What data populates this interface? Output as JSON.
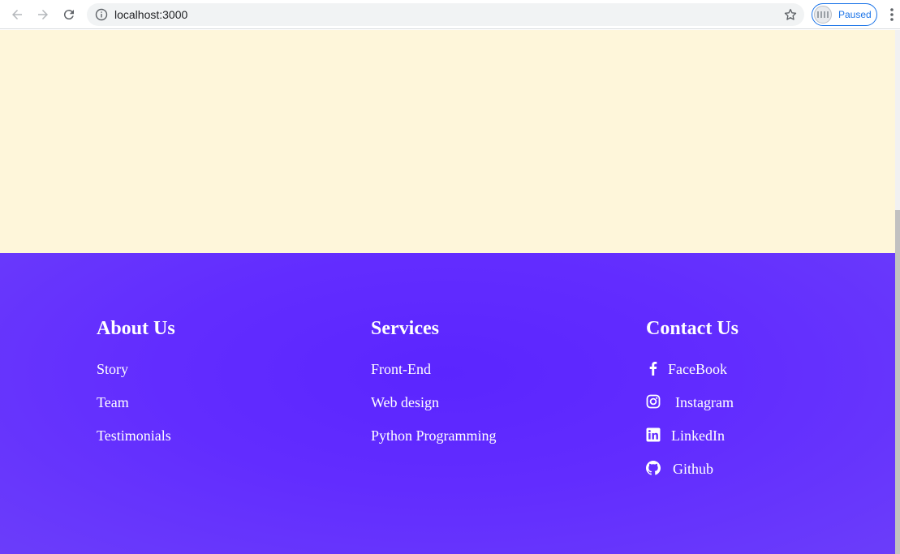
{
  "browser": {
    "url": "localhost:3000",
    "profile_status": "Paused",
    "icons": [
      "back-arrow-icon",
      "forward-arrow-icon",
      "reload-icon",
      "info-icon",
      "star-icon",
      "kebab-menu-icon"
    ]
  },
  "colors": {
    "hero_bg": "#fef6da",
    "footer_bg": "#622cff",
    "text": "#ffffff"
  },
  "footer": {
    "about": {
      "heading": "About Us",
      "links": [
        "Story",
        "Team",
        "Testimonials"
      ]
    },
    "services": {
      "heading": "Services",
      "links": [
        "Front-End",
        "Web design",
        "Python Programming"
      ]
    },
    "contact": {
      "heading": "Contact Us",
      "links": [
        {
          "label": "FaceBook",
          "icon": "facebook-icon"
        },
        {
          "label": "Instagram",
          "icon": "instagram-icon"
        },
        {
          "label": "LinkedIn",
          "icon": "linkedin-icon"
        },
        {
          "label": "Github",
          "icon": "github-icon"
        }
      ]
    }
  }
}
